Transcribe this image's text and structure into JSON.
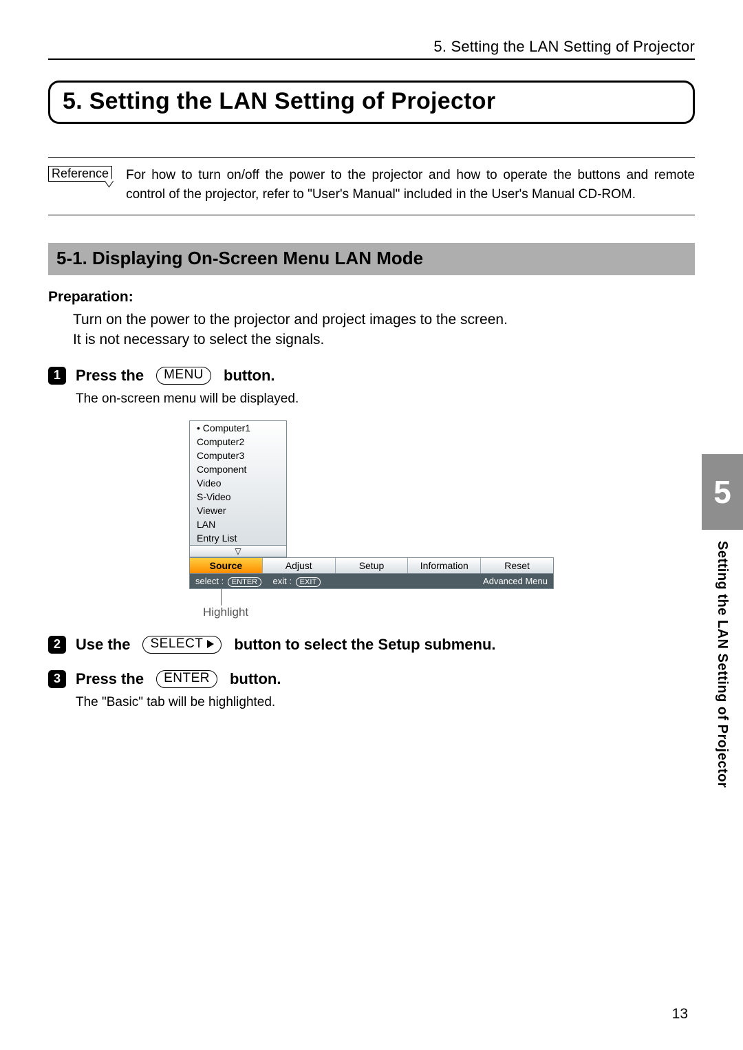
{
  "running_head": "5. Setting the LAN Setting of Projector",
  "chapter_title": "5.  Setting the LAN Setting of Projector",
  "reference": {
    "label": "Reference",
    "text": "For how to turn on/off the power to the projector and how to operate the buttons and remote control of the projector, refer to \"User's Manual\" included in the User's Manual CD-ROM."
  },
  "section_title": "5-1.  Displaying On-Screen Menu LAN Mode",
  "preparation": {
    "label": "Preparation:",
    "line1": "Turn on the power to the projector and project images to the screen.",
    "line2": "It is not necessary to select the signals."
  },
  "steps": {
    "s1_pre": "Press the ",
    "s1_btn": "MENU",
    "s1_post": " button.",
    "s1_note": "The on-screen menu will be displayed.",
    "s2_pre": "Use the ",
    "s2_btn": "SELECT",
    "s2_post": " button to select the Setup submenu.",
    "s3_pre": "Press the ",
    "s3_btn": "ENTER",
    "s3_post": " button.",
    "s3_note": "The \"Basic\" tab will be highlighted."
  },
  "osd": {
    "items": [
      "Computer1",
      "Computer2",
      "Computer3",
      "Component",
      "Video",
      "S-Video",
      "Viewer",
      "LAN",
      "Entry List"
    ],
    "tabs": [
      "Source",
      "Adjust",
      "Setup",
      "Information",
      "Reset"
    ],
    "status_select": "select :",
    "status_enter": "ENTER",
    "status_exit_label": "exit :",
    "status_exit": "EXIT",
    "status_right": "Advanced Menu",
    "highlight": "Highlight",
    "down_glyph": "▽"
  },
  "side": {
    "num": "5",
    "text": "Setting the LAN Setting of Projector"
  },
  "page_number": "13"
}
